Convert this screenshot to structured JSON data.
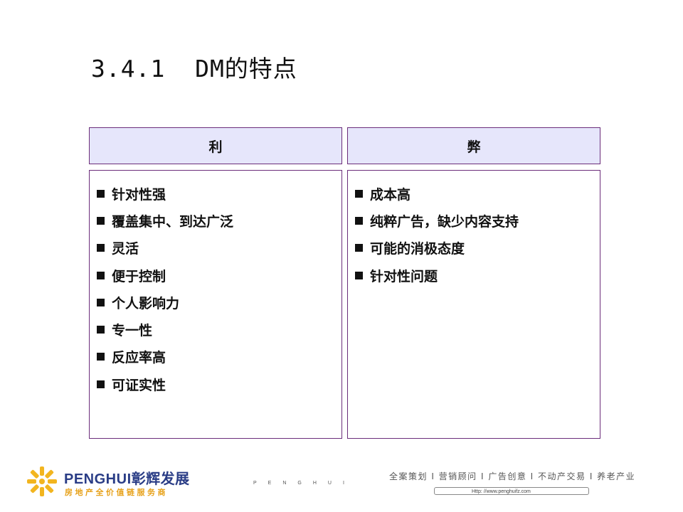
{
  "title": "3.4.1  DM的特点",
  "columns": [
    {
      "header": "利",
      "items": [
        "针对性强",
        "覆盖集中、到达广泛",
        "灵活",
        "便于控制",
        "个人影响力",
        "专一性",
        "反应率高",
        "可证实性"
      ]
    },
    {
      "header": "弊",
      "items": [
        "成本高",
        "纯粹广告，缺少内容支持",
        "可能的消极态度",
        "针对性问题"
      ]
    }
  ],
  "footer": {
    "brand_en": "PENGHUI",
    "brand_cn": "彰辉发展",
    "brand_sub": "房地产全价值链服务商",
    "spaced_text": "PENGHUI",
    "slogan": "全案策划 I 营销顾问 I 广告创意 I 不动产交易 I 养老产业",
    "url": "Http: //www.penghuifz.com"
  },
  "colors": {
    "header_bg": "#e6e6fb",
    "border": "#6b2d7a",
    "brand_blue": "#2a3d86",
    "brand_orange": "#e7a21b"
  }
}
